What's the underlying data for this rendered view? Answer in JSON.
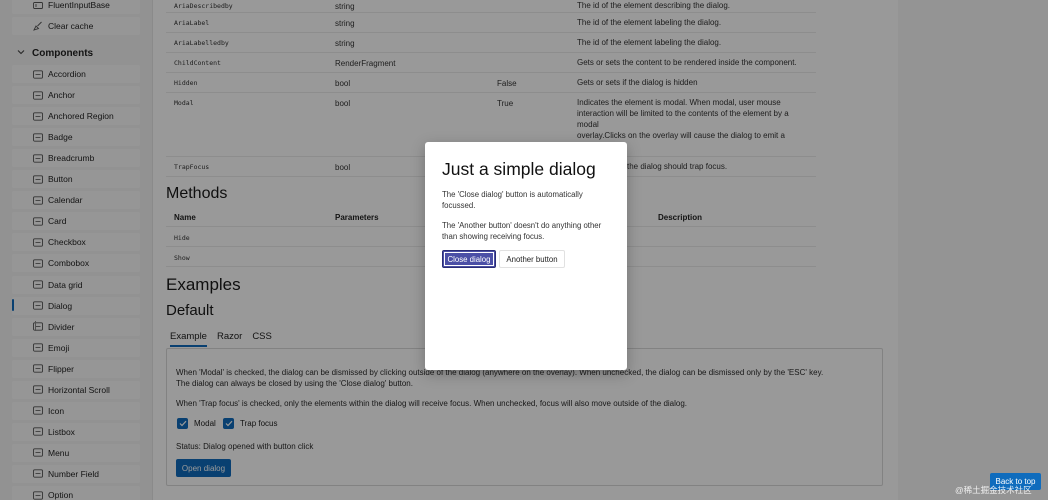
{
  "sidebar": {
    "top_items": [
      {
        "label": "FluentInputBase",
        "icon": "input-icon"
      },
      {
        "label": "Clear cache",
        "icon": "broom-icon"
      }
    ],
    "group_label": "Components",
    "items": [
      {
        "label": "Accordion",
        "icon": "accordion-icon"
      },
      {
        "label": "Anchor",
        "icon": "anchor-icon"
      },
      {
        "label": "Anchored Region",
        "icon": "region-icon"
      },
      {
        "label": "Badge",
        "icon": "badge-icon"
      },
      {
        "label": "Breadcrumb",
        "icon": "breadcrumb-icon"
      },
      {
        "label": "Button",
        "icon": "button-icon"
      },
      {
        "label": "Calendar",
        "icon": "calendar-icon"
      },
      {
        "label": "Card",
        "icon": "card-icon"
      },
      {
        "label": "Checkbox",
        "icon": "checkbox-icon"
      },
      {
        "label": "Combobox",
        "icon": "combobox-icon"
      },
      {
        "label": "Data grid",
        "icon": "grid-icon"
      },
      {
        "label": "Dialog",
        "icon": "dialog-icon"
      },
      {
        "label": "Divider",
        "icon": "divider-icon"
      },
      {
        "label": "Emoji",
        "icon": "emoji-icon"
      },
      {
        "label": "Flipper",
        "icon": "flipper-icon"
      },
      {
        "label": "Horizontal Scroll",
        "icon": "scroll-icon"
      },
      {
        "label": "Icon",
        "icon": "icon-icon"
      },
      {
        "label": "Listbox",
        "icon": "listbox-icon"
      },
      {
        "label": "Menu",
        "icon": "menu-icon"
      },
      {
        "label": "Number Field",
        "icon": "number-field-icon"
      },
      {
        "label": "Option",
        "icon": "option-icon"
      }
    ]
  },
  "params": {
    "rows": [
      {
        "name": "AriaDescribedby",
        "type": "string",
        "default": "",
        "desc": [
          "The id of the element describing the dialog."
        ]
      },
      {
        "name": "AriaLabel",
        "type": "string",
        "default": "",
        "desc": [
          "The id of the element labeling the dialog."
        ]
      },
      {
        "name": "AriaLabelledby",
        "type": "string",
        "default": "",
        "desc": [
          "The id of the element labeling the dialog."
        ]
      },
      {
        "name": "ChildContent",
        "type": "RenderFragment",
        "default": "",
        "desc": [
          "Gets or sets the content to be rendered inside the component."
        ]
      },
      {
        "name": "Hidden",
        "type": "bool",
        "default": "False",
        "desc": [
          "Gets or sets if the dialog is hidden"
        ]
      },
      {
        "name": "Modal",
        "type": "bool",
        "default": "True",
        "desc": [
          "Indicates the element is modal. When modal, user mouse",
          "interaction will be limited to the contents of the element by a",
          "modal",
          "overlay.Clicks on the overlay will cause the dialog to emit a"
        ]
      },
      {
        "name": "TrapFocus",
        "type": "bool",
        "default": "",
        "desc": [
          "the dialog should trap focus."
        ]
      }
    ]
  },
  "methods": {
    "title": "Methods",
    "headers": {
      "name": "Name",
      "params": "Parameters",
      "desc": "Description"
    },
    "rows": [
      "Hide",
      "Show"
    ]
  },
  "examples": {
    "title": "Examples",
    "subtitle": "Default",
    "tabs": [
      "Example",
      "Razor",
      "CSS"
    ],
    "line1a": "When 'Modal' is checked, the dialog can be dismissed by clicking outside of the dialog (anywhere on the overlay). When unchecked, the dialog can be dismissed only by the 'ESC' key.",
    "line1b": "The dialog can always be closed by using the 'Close dialog' button.",
    "line2": "When 'Trap focus' is checked, only the elements within the dialog will receive focus. When unchecked, focus will also move outside of the dialog.",
    "cb_modal": "Modal",
    "cb_trap": "Trap focus",
    "status": "Status: Dialog opened with button click",
    "open_button": "Open dialog"
  },
  "dialog": {
    "title": "Just a simple dialog",
    "text1": "The 'Close dialog' button is automatically focussed.",
    "text2": "The 'Another button' doesn't do anything other than showing receiving focus.",
    "close_button": "Close dialog",
    "another_button": "Another button"
  },
  "back_to_top": "Back to top",
  "watermark": "@稀土掘金技术社区"
}
